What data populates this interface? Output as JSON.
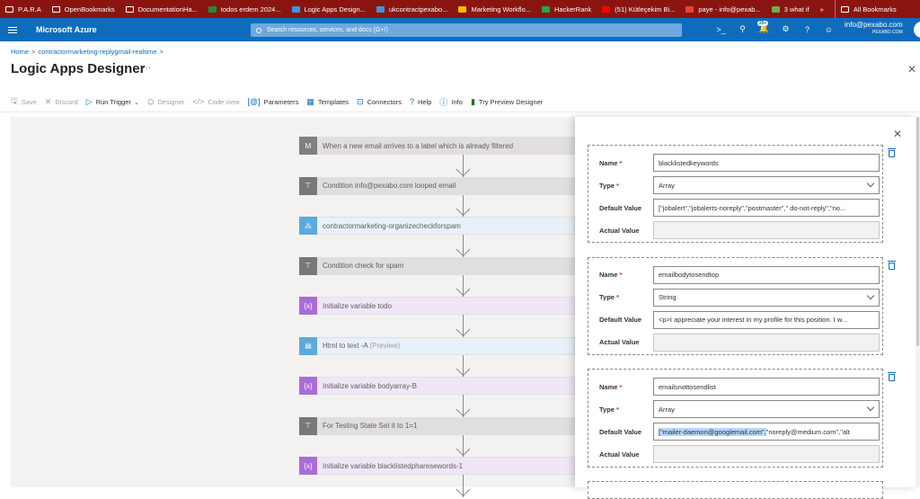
{
  "bookmarks": [
    {
      "label": "P.A.R.A",
      "icon": "folder-icon"
    },
    {
      "label": "OpenBookmarks",
      "icon": "folder-icon"
    },
    {
      "label": "DocumentationHa...",
      "icon": "folder-icon"
    },
    {
      "label": "todos erdem 2024...",
      "icon": "sheets-icon"
    },
    {
      "label": "Logic Apps Design...",
      "icon": "azure-icon"
    },
    {
      "label": "ukcontractpexabo...",
      "icon": "azure-icon"
    },
    {
      "label": "Marketing Workflo...",
      "icon": "drive-icon"
    },
    {
      "label": "HackerRank",
      "icon": "hackerrank-icon"
    },
    {
      "label": "(51) Kütleçekim Bi...",
      "icon": "youtube-icon"
    },
    {
      "label": "paye - info@pexab...",
      "icon": "gmail-icon"
    },
    {
      "label": "3 what if",
      "icon": "page-icon"
    },
    {
      "label": "»",
      "icon": ""
    },
    {
      "label": "All Bookmarks",
      "icon": "folder-icon"
    }
  ],
  "topbar": {
    "brand": "Microsoft Azure",
    "search_placeholder": "Search resources, services, and docs (G+/)",
    "notif_count": "20+",
    "user_email": "info@pexabo.com",
    "user_company": "PEXABO.COM"
  },
  "breadcrumb": {
    "home": "Home",
    "resource": "contractormarketing-replygmail-realtime",
    "sep": ">"
  },
  "page": {
    "title": "Logic Apps Designer",
    "more": "···",
    "close": "✕"
  },
  "commands": [
    {
      "label": "Save",
      "icon": "save-icon",
      "enabled": false
    },
    {
      "label": "Discard",
      "icon": "discard-icon",
      "enabled": false
    },
    {
      "label": "Run Trigger",
      "icon": "run-icon",
      "enabled": true
    },
    {
      "label": "Designer",
      "icon": "designer-icon",
      "enabled": false
    },
    {
      "label": "Code view",
      "icon": "code-icon",
      "enabled": false
    },
    {
      "label": "Parameters",
      "icon": "parameters-icon",
      "enabled": true
    },
    {
      "label": "Templates",
      "icon": "templates-icon",
      "enabled": true
    },
    {
      "label": "Connectors",
      "icon": "connectors-icon",
      "enabled": true
    },
    {
      "label": "Help",
      "icon": "help-icon",
      "enabled": true
    },
    {
      "label": "Info",
      "icon": "info-icon",
      "enabled": true
    },
    {
      "label": "Try Preview Designer",
      "icon": "preview-icon",
      "enabled": true
    }
  ],
  "steps": [
    {
      "label": "When a new email arrives to a label which is already filtered",
      "preview": "",
      "icon": "gmail-icon",
      "icon_bg": "#7f7f7f",
      "bg": "#e1dfdd"
    },
    {
      "label": "Condition info@pexabo.com looped email",
      "preview": "",
      "icon": "condition-icon",
      "icon_bg": "#7a7876",
      "bg": "#e1dfdd"
    },
    {
      "label": "contractormarketing-organizecheckforspam",
      "preview": "",
      "icon": "workflow-icon",
      "icon_bg": "#5ca9de",
      "bg": "#e8f1fa"
    },
    {
      "label": "Condition check for spam",
      "preview": "",
      "icon": "condition-icon",
      "icon_bg": "#7a7876",
      "bg": "#e1dfdd"
    },
    {
      "label": "Initialize variable todo",
      "preview": "",
      "icon": "variable-icon",
      "icon_bg": "#a86ed5",
      "bg": "#f0e6f8"
    },
    {
      "label": "Html to text -A",
      "preview": "(Preview)",
      "icon": "html-icon",
      "icon_bg": "#5ca9de",
      "bg": "#e8f1fa"
    },
    {
      "label": "Initialize variable bodyarray-B",
      "preview": "",
      "icon": "variable-icon",
      "icon_bg": "#a86ed5",
      "bg": "#f0e6f8"
    },
    {
      "label": "For Testing State Set it to 1=1",
      "preview": "",
      "icon": "condition-icon",
      "icon_bg": "#7a7876",
      "bg": "#e1dfdd"
    },
    {
      "label": "Initialize variable blacklistedpharesewords-1",
      "preview": "",
      "icon": "variable-icon",
      "icon_bg": "#a86ed5",
      "bg": "#f0e6f8"
    }
  ],
  "panel": {
    "field_labels": {
      "name": "Name",
      "type": "Type",
      "default": "Default Value",
      "actual": "Actual Value",
      "required": "*"
    },
    "parameters": [
      {
        "name": "blacklistedkeywords",
        "type": "Array",
        "default_value": "[\"jobalert\",\"jobalerts-noreply\",\"postmaster\",\" do-not-reply\",\"no...",
        "default_selected": "",
        "default_rest": "",
        "actual_value": ""
      },
      {
        "name": "emailbodytosendtop",
        "type": "String",
        "default_value": "<p>I appreciate your interest in my profile for this position. I w...",
        "default_selected": "",
        "default_rest": "",
        "actual_value": ""
      },
      {
        "name": "emailsnottosendlist",
        "type": "Array",
        "default_value": "",
        "default_selected": "[\"mailer-daemon@googlemail.com\",",
        "default_rest": "\"noreply@medium.com\",\"alt",
        "actual_value": ""
      }
    ]
  }
}
